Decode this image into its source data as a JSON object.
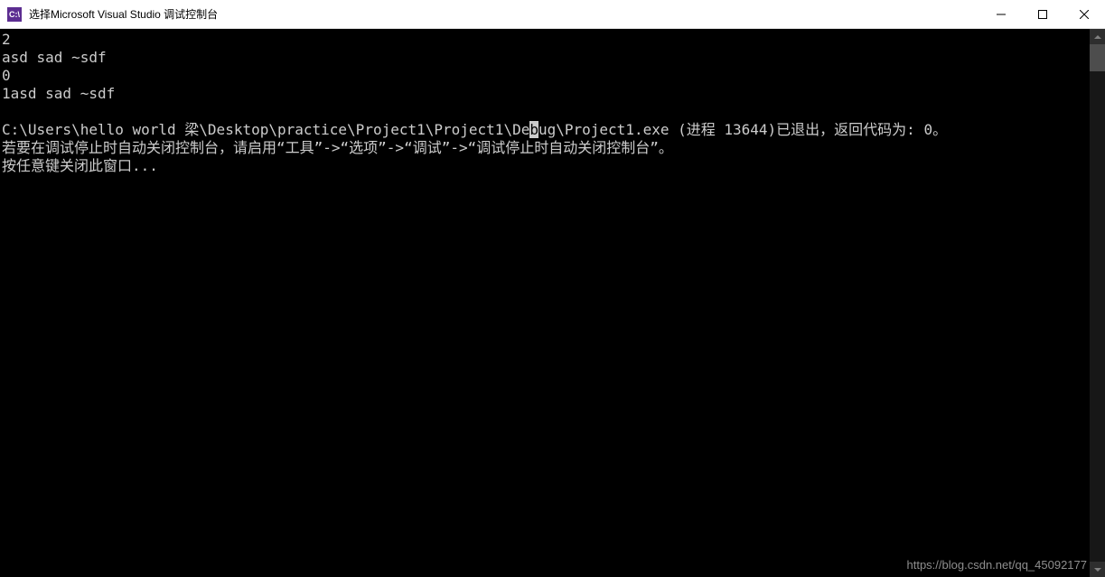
{
  "window": {
    "title": "选择Microsoft Visual Studio 调试控制台",
    "app_icon_text": "C:\\"
  },
  "console": {
    "lines": [
      "2",
      "asd sad ~sdf",
      "0",
      "1asd sad ~sdf",
      "",
      {
        "pre": "C:\\Users\\hello world 梁\\Desktop\\practice\\Project1\\Project1\\De",
        "cursor": "b",
        "post": "ug\\Project1.exe (进程 13644)已退出，返回代码为: 0。"
      },
      "若要在调试停止时自动关闭控制台，请启用“工具”->“选项”->“调试”->“调试停止时自动关闭控制台”。",
      "按任意键关闭此窗口..."
    ]
  },
  "watermark": "https://blog.csdn.net/qq_45092177"
}
